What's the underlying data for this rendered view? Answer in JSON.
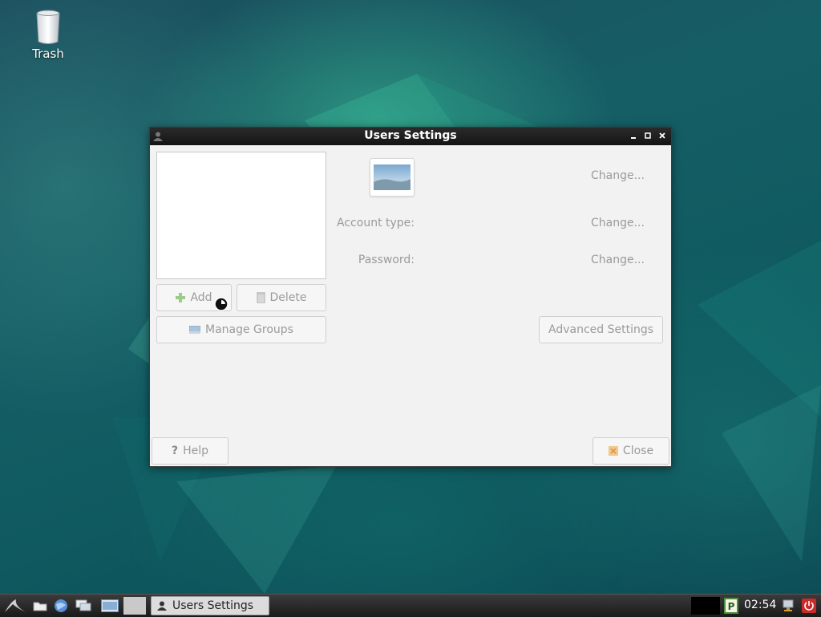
{
  "desktop": {
    "trash_label": "Trash"
  },
  "window": {
    "title": "Users Settings",
    "buttons": {
      "add": "Add",
      "delete": "Delete",
      "manage_groups": "Manage Groups",
      "advanced_settings": "Advanced Settings",
      "help": "Help",
      "close": "Close"
    },
    "fields": {
      "account_type_label": "Account type:",
      "password_label": "Password:",
      "change_picture": "Change...",
      "change_account_type": "Change...",
      "change_password": "Change..."
    }
  },
  "taskbar": {
    "task_label": "Users Settings",
    "clock": "02:54"
  },
  "icons": [
    "trash-icon",
    "app-icon",
    "minimize-icon",
    "maximize-icon",
    "close-icon",
    "add-icon",
    "delete-icon",
    "manage-groups-icon",
    "help-icon",
    "close-button-icon",
    "start-menu-icon",
    "file-manager-icon",
    "browser-icon",
    "show-desktop-icon",
    "terminal-icon",
    "package-icon",
    "network-icon",
    "power-icon"
  ]
}
